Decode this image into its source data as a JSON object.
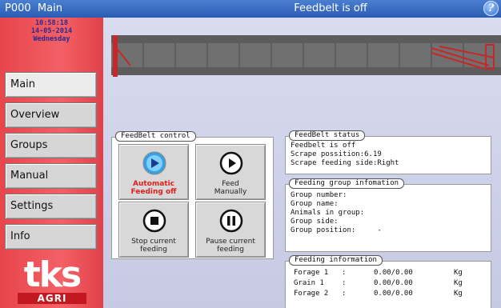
{
  "titlebar": {
    "screen_id": "P000",
    "screen_name": "Main",
    "status": "Feedbelt is off",
    "help_label": "?"
  },
  "sidebar": {
    "time": "10:58:18",
    "date": "14-05-2014",
    "weekday": "Wednesday",
    "items": [
      {
        "label": "Main"
      },
      {
        "label": "Overview"
      },
      {
        "label": "Groups"
      },
      {
        "label": "Manual"
      },
      {
        "label": "Settings"
      },
      {
        "label": "Info"
      }
    ],
    "logo_text": "tks",
    "logo_sub": "AGRI"
  },
  "feedbelt_control": {
    "title": "FeedBelt control",
    "buttons": [
      {
        "line1": "Automatic",
        "line2": "Feeding off"
      },
      {
        "line1": "Feed",
        "line2": "Manually"
      },
      {
        "line1": "Stop current",
        "line2": "feeding"
      },
      {
        "line1": "Pause current",
        "line2": "feeding"
      }
    ]
  },
  "feedbelt_status": {
    "title": "FeedBelt status",
    "line1": "Feedbelt is off",
    "line2": "Scrape possition:6.19",
    "line3": "Scrape feeding side:Right"
  },
  "feeding_group": {
    "title": "Feeding group infomation",
    "lines": [
      "Group number:",
      "Group name:",
      "Animals in group:",
      "Group side:",
      "Group position:     -"
    ]
  },
  "feeding_info": {
    "title": "Feeding information",
    "rows": [
      {
        "name": "Forage 1",
        "sep": ":",
        "value": "0.00/0.00",
        "unit": "Kg"
      },
      {
        "name": "Grain 1",
        "sep": ":",
        "value": "0.00/0.00",
        "unit": "Kg"
      },
      {
        "name": "Forage 2",
        "sep": ":",
        "value": "0.00/0.00",
        "unit": "Kg"
      }
    ]
  },
  "colors": {
    "titlebar": "#2a5cb4",
    "sidebar": "#f05a60",
    "belt": "#6a6a6a",
    "belt_frame": "#c62828",
    "auto_label": "#e0201e"
  }
}
